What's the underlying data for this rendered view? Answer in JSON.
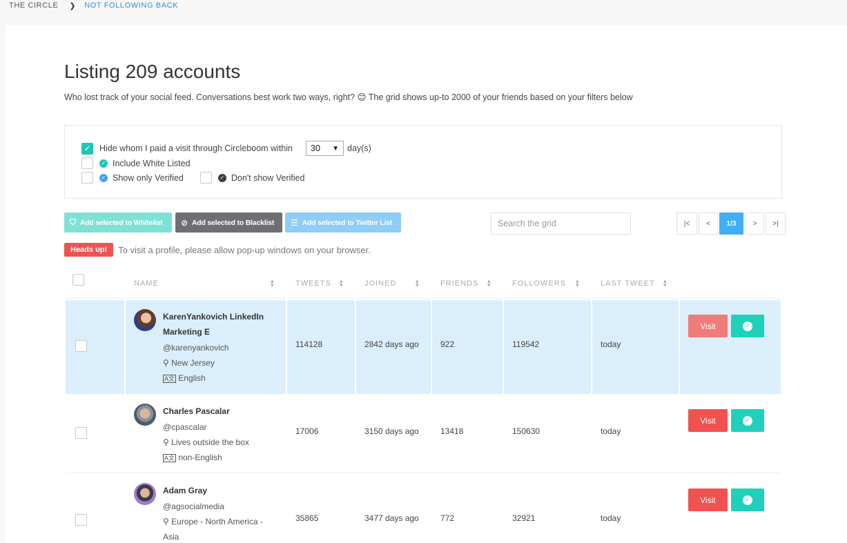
{
  "breadcrumb": {
    "root": "THE CIRCLE",
    "separator": "❯",
    "current": "NOT FOLLOWING BACK"
  },
  "header": {
    "title_prefix": "Listing",
    "title_count": "209 accounts",
    "subtitle": "Who lost track of your social feed. Conversations best work two ways, right? 😊 The grid shows up-to 2000 of your friends based on your filters below"
  },
  "filters": {
    "hide_visited_label": "Hide whom I paid a visit through Circleboom within",
    "hide_visited_checked": true,
    "days_value": "30",
    "days_unit": "day(s)",
    "include_whitelisted_label": "Include White Listed",
    "only_verified_label": "Show only Verified",
    "dont_show_verified_label": "Don't show Verified"
  },
  "actions": {
    "whitelist": "Add selected to Whitelist",
    "blacklist": "Add selected to Blacklist",
    "twitter_list": "Add selected to Twitter List"
  },
  "search": {
    "placeholder": "Search the grid"
  },
  "pagination": {
    "first": "|<",
    "prev": "<",
    "current": "1/3",
    "next": ">",
    "last": ">|"
  },
  "notice": {
    "badge": "Heads up!",
    "text": "To visit a profile, please allow pop-up windows on your browser."
  },
  "table": {
    "columns": [
      "NAME",
      "TWEETS",
      "JOINED",
      "FRIENDS",
      "FOLLOWERS",
      "LAST TWEET"
    ],
    "rows": [
      {
        "name_line1": "KarenYankovich LinkedIn",
        "name_line2": "Marketing E",
        "handle": "@karenyankovich",
        "location": "New Jersey",
        "language": "English",
        "tweets": "114128",
        "joined": "2842 days ago",
        "friends": "922",
        "followers": "119542",
        "last_tweet": "today",
        "visit": "Visit",
        "selected": true
      },
      {
        "name_line1": "Charles Pascalar",
        "handle": "@cpascalar",
        "location": "Lives outside the box",
        "language": "non-English",
        "tweets": "17006",
        "joined": "3150 days ago",
        "friends": "13418",
        "followers": "150630",
        "last_tweet": "today",
        "visit": "Visit",
        "selected": false
      },
      {
        "name_line1": "Adam Gray",
        "handle": "@agsocialmedia",
        "location_line1": "Europe - North America -",
        "location_line2": "Asia",
        "tweets": "35865",
        "joined": "3477 days ago",
        "friends": "772",
        "followers": "32921",
        "last_tweet": "today",
        "visit": "Visit",
        "selected": false
      }
    ]
  },
  "colors": {
    "accent": "#1fc6b4",
    "danger": "#f0524f",
    "primary": "#41aef5",
    "link": "#2f8fd8"
  }
}
